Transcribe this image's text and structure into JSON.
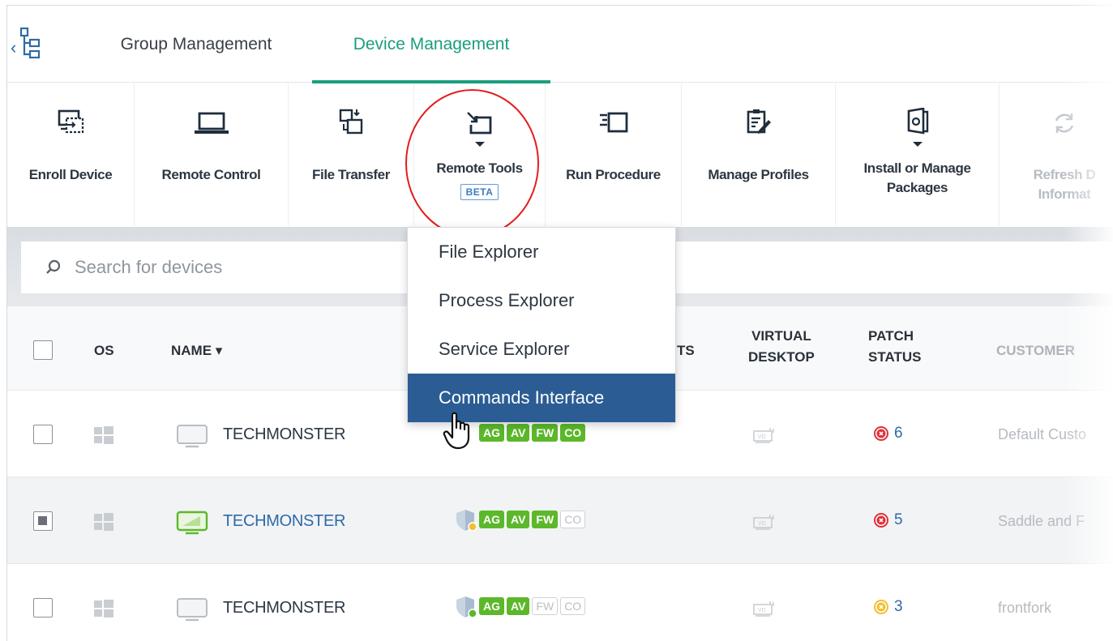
{
  "tabs": {
    "group_management": "Group Management",
    "device_management": "Device Management"
  },
  "toolbar": {
    "enroll_device": "Enroll Device",
    "remote_control": "Remote Control",
    "file_transfer": "File Transfer",
    "remote_tools": "Remote Tools",
    "remote_tools_badge": "BETA",
    "run_procedure": "Run Procedure",
    "manage_profiles": "Manage Profiles",
    "install_manage_line1": "Install or Manage",
    "install_manage_line2": "Packages",
    "refresh_line1": "Refresh D",
    "refresh_line2": "Informat"
  },
  "search": {
    "placeholder": "Search for devices"
  },
  "remote_tools_menu": {
    "items": [
      "File Explorer",
      "Process Explorer",
      "Service Explorer",
      "Commands Interface"
    ],
    "highlighted": "Commands Interface"
  },
  "table": {
    "headers": {
      "os": "OS",
      "name": "NAME",
      "name_sort": "▾",
      "agents_partial": "TS",
      "virtual_desktop_line1": "VIRTUAL",
      "virtual_desktop_line2": "DESKTOP",
      "patch_status_line1": "PATCH",
      "patch_status_line2": "STATUS",
      "customer": "CUSTOMER"
    },
    "rows": [
      {
        "name": "TECHMONSTER",
        "checked": false,
        "pills": [
          {
            "t": "AG",
            "on": true
          },
          {
            "t": "AV",
            "on": true
          },
          {
            "t": "FW",
            "on": true
          },
          {
            "t": "CO",
            "on": true
          }
        ],
        "patch_count": "6",
        "customer": "Default Custo"
      },
      {
        "name": "TECHMONSTER",
        "checked": true,
        "pills": [
          {
            "t": "AG",
            "on": true
          },
          {
            "t": "AV",
            "on": true
          },
          {
            "t": "FW",
            "on": true
          },
          {
            "t": "CO",
            "on": false
          }
        ],
        "patch_count": "5",
        "customer": "Saddle and F"
      },
      {
        "name": "TECHMONSTER",
        "checked": false,
        "pills": [
          {
            "t": "AG",
            "on": true
          },
          {
            "t": "AV",
            "on": true
          },
          {
            "t": "FW",
            "on": false
          },
          {
            "t": "CO",
            "on": false
          }
        ],
        "patch_count": "3",
        "customer": "frontfork"
      }
    ]
  },
  "colors": {
    "accent_green": "#1aa07e",
    "selected_blue": "#2b5d94",
    "link_blue": "#2f6aa8",
    "pill_green": "#5cb82a",
    "error_red": "#e0303a",
    "warning_yellow": "#f2c02e",
    "highlight_circle": "#e21d1d"
  },
  "icons": {
    "tree": "device-tree-icon",
    "search": "search-icon",
    "windows": "windows-logo-icon",
    "monitor": "monitor-icon",
    "shield": "shield-icon",
    "vd": "virtual-desktop-icon",
    "patch_error": "patch-error-icon",
    "patch_warning": "patch-warning-icon"
  }
}
